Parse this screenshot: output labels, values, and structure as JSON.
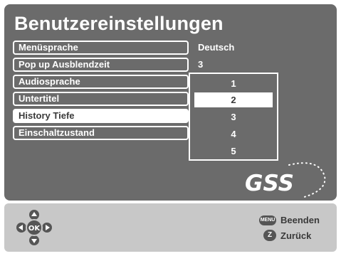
{
  "screen": {
    "title": "Benutzereinstellungen",
    "colors": {
      "panel": "#6b6b6b",
      "text": "#ffffff",
      "selected_bg": "#ffffff",
      "selected_text": "#3a3a3a",
      "footer": "#c8c8c8"
    }
  },
  "menu": {
    "items": [
      {
        "label": "Menüsprache",
        "value": "Deutsch"
      },
      {
        "label": "Pop up Ausblendzeit",
        "value": "3"
      },
      {
        "label": "Audiosprache"
      },
      {
        "label": "Untertitel"
      },
      {
        "label": "History Tiefe",
        "selected": true
      },
      {
        "label": "Einschaltzustand"
      }
    ]
  },
  "popup": {
    "options": [
      "1",
      "2",
      "3",
      "4",
      "5"
    ],
    "selected_value": "2"
  },
  "logo": {
    "text": "GSS",
    "icon": "gss-logo-icon"
  },
  "footer": {
    "nav_icon": "navigation-pad-icon",
    "ok_label": "OK",
    "actions": [
      {
        "button": "MENU",
        "label": "Beenden",
        "icon": "menu-button-icon"
      },
      {
        "button": "Z",
        "label": "Zurück",
        "icon": "z-button-icon"
      }
    ]
  }
}
